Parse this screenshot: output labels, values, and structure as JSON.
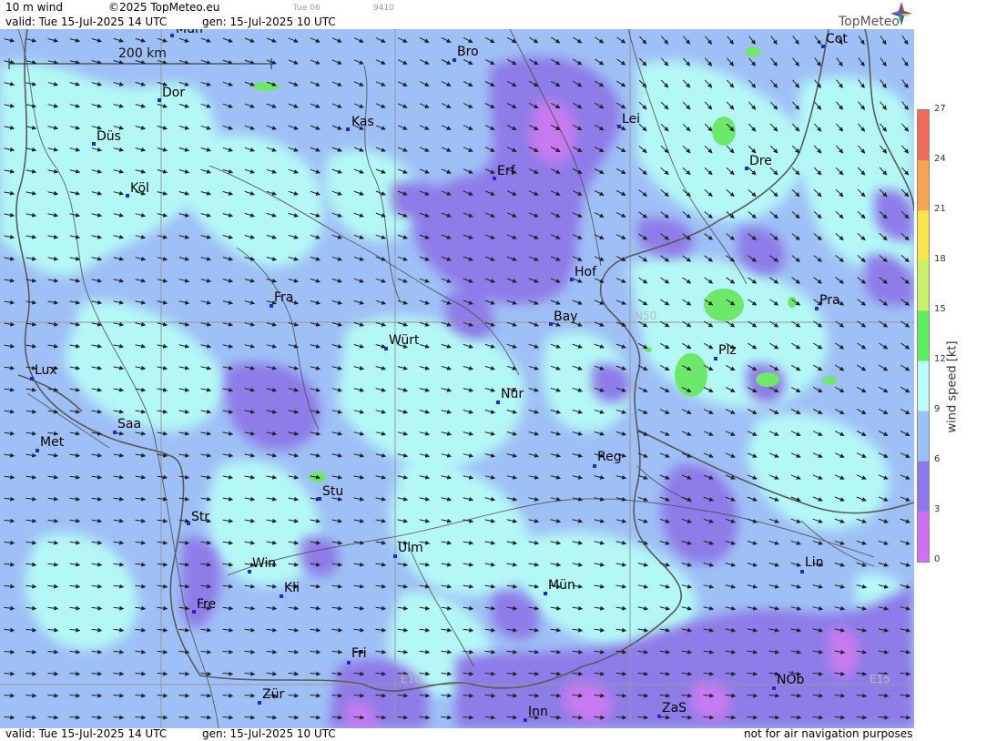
{
  "header": {
    "title": "10 m wind",
    "copyright": "©2025 TopMeteo.eu",
    "run_label": "Tue 06",
    "code": "9410",
    "valid": "valid:  Tue  15-Jul-2025  14 UTC",
    "generated": "gen: 15-Jul-2025 10 UTC",
    "logo_text": "TopMeteo"
  },
  "footer": {
    "valid": "valid:  Tue  15-Jul-2025  14 UTC",
    "generated": "gen: 15-Jul-2025 10 UTC",
    "disclaimer": "not for air navigation purposes"
  },
  "map": {
    "scale_label": "200 km",
    "grid_labels": [
      "N50",
      "E10",
      "E15"
    ],
    "cities": [
      {
        "name": "Mün",
        "id": "munster"
      },
      {
        "name": "Bro",
        "id": "brocken"
      },
      {
        "name": "Cot",
        "id": "cottbus"
      },
      {
        "name": "Dor",
        "id": "dortmund"
      },
      {
        "name": "Kas",
        "id": "kassel"
      },
      {
        "name": "Lei",
        "id": "leipzig"
      },
      {
        "name": "Düs",
        "id": "dusseldorf"
      },
      {
        "name": "Erf",
        "id": "erfurt"
      },
      {
        "name": "Dre",
        "id": "dresden"
      },
      {
        "name": "Köl",
        "id": "koln"
      },
      {
        "name": "Hof",
        "id": "hof"
      },
      {
        "name": "Fra",
        "id": "frankfurt"
      },
      {
        "name": "Pra",
        "id": "praha"
      },
      {
        "name": "Bay",
        "id": "bayreuth"
      },
      {
        "name": "Würt",
        "id": "wurzburg"
      },
      {
        "name": "Plz",
        "id": "plzen"
      },
      {
        "name": "Lux",
        "id": "luxembourg"
      },
      {
        "name": "Nür",
        "id": "nurnberg"
      },
      {
        "name": "Saa",
        "id": "saarbrucken"
      },
      {
        "name": "Met",
        "id": "metz"
      },
      {
        "name": "Reg",
        "id": "regensburg"
      },
      {
        "name": "Stu",
        "id": "stuttgart"
      },
      {
        "name": "Str",
        "id": "strasbourg"
      },
      {
        "name": "Ulm",
        "id": "ulm"
      },
      {
        "name": "Lin",
        "id": "linz"
      },
      {
        "name": "Win",
        "id": "win"
      },
      {
        "name": "Mün",
        "id": "munchen"
      },
      {
        "name": "Kli",
        "id": "kli"
      },
      {
        "name": "Fre",
        "id": "freiburg"
      },
      {
        "name": "Fri",
        "id": "friedrichshafen"
      },
      {
        "name": "NÖb",
        "id": "noeb"
      },
      {
        "name": "Zür",
        "id": "zurich"
      },
      {
        "name": "Inn",
        "id": "innsbruck"
      },
      {
        "name": "ZaS",
        "id": "zas"
      }
    ]
  },
  "legend": {
    "unit_label": "wind speed [kt]",
    "ticks": [
      "27",
      "24",
      "21",
      "18",
      "15",
      "12",
      "9",
      "6",
      "3",
      "0"
    ],
    "colors": [
      "#ef6a5a",
      "#f5a552",
      "#f6e648",
      "#c8f06a",
      "#5ded5e",
      "#b8fbf8",
      "#9ac0f5",
      "#8a78ec",
      "#cc72ef"
    ]
  },
  "colors": {
    "light_blue": "#9ec0f6",
    "cyan": "#b4f8f6",
    "purple": "#8e7ce8",
    "violet": "#c77af0",
    "green": "#6ee86a",
    "border": "#5a5a5a",
    "river": "#444444",
    "grid": "#999999"
  }
}
